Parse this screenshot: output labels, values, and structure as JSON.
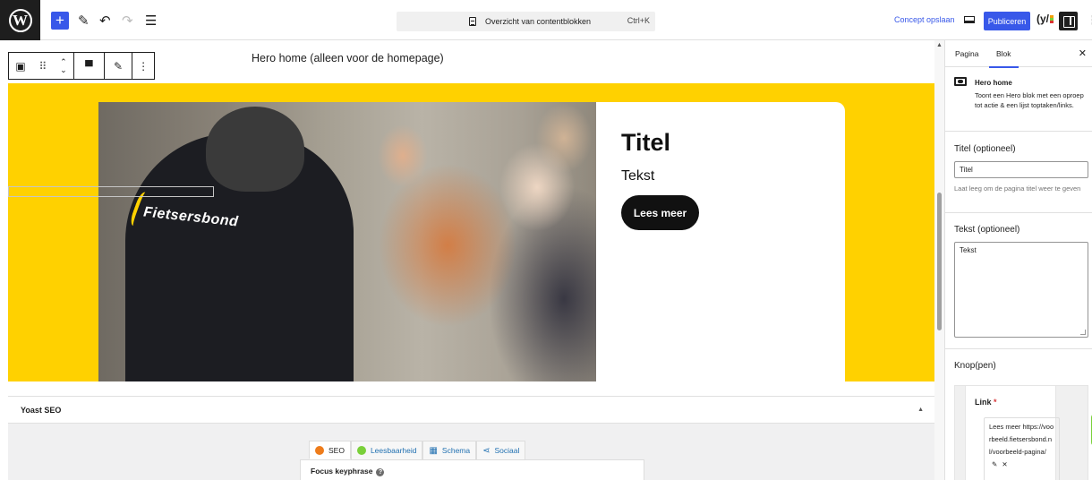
{
  "topbar": {
    "command_bar": {
      "label": "Overzicht van contentblokken",
      "shortcut": "Ctrl+K"
    },
    "draft_label": "Concept opslaan",
    "publish_label": "Publiceren",
    "yoast_label": "(y/"
  },
  "canvas": {
    "block_title": "Hero home (alleen voor de homepage)",
    "hero": {
      "image_text": "Fietsersbond",
      "title": "Titel",
      "text": "Tekst",
      "button": "Lees meer"
    },
    "yoast": {
      "heading": "Yoast SEO",
      "tabs": [
        {
          "label": "SEO",
          "color": "#ee7c1b"
        },
        {
          "label": "Leesbaarheid",
          "color": "#7ad03a"
        },
        {
          "label": "Schema",
          "color": "#2271b1"
        },
        {
          "label": "Sociaal",
          "color": "#2271b1"
        }
      ],
      "focus_label": "Focus keyphrase",
      "help_glyph": "?"
    }
  },
  "sidebar": {
    "tabs": [
      "Pagina",
      "Blok"
    ],
    "active_tab": "Blok",
    "block": {
      "name": "Hero home",
      "description": "Toont een Hero blok met een oproep tot actie & een lijst toptaken/links."
    },
    "title_field": {
      "label": "Titel (optioneel)",
      "value": "Titel",
      "help": "Laat leeg om de pagina titel weer te geven"
    },
    "text_field": {
      "label": "Tekst (optioneel)",
      "value": "Tekst"
    },
    "buttons_field": {
      "label": "Knop(pen)",
      "link_label": "Link",
      "required_mark": "*",
      "link_value": "Lees meer  https://voorbeeld.fietsersbond.nl/voorbeeld-pagina/"
    }
  },
  "colors": {
    "accent": "#3858e9",
    "hero_bg": "#ffd100",
    "dark": "#1e1e1e"
  }
}
